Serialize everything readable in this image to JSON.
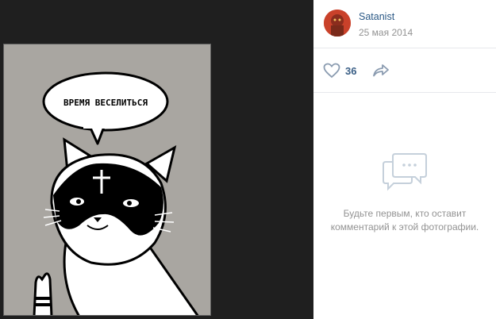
{
  "photo": {
    "speech_bubble_text": "ВРЕМЯ ВЕСЕЛИТЬСЯ"
  },
  "post": {
    "author": "Satanist",
    "date": "25 мая 2014",
    "likes": "36"
  },
  "comments": {
    "empty_text": "Будьте первым, кто оставит комментарий к этой фотографии."
  },
  "colors": {
    "link": "#2a5885",
    "muted": "#939393",
    "icon": "#a8b6c6"
  }
}
